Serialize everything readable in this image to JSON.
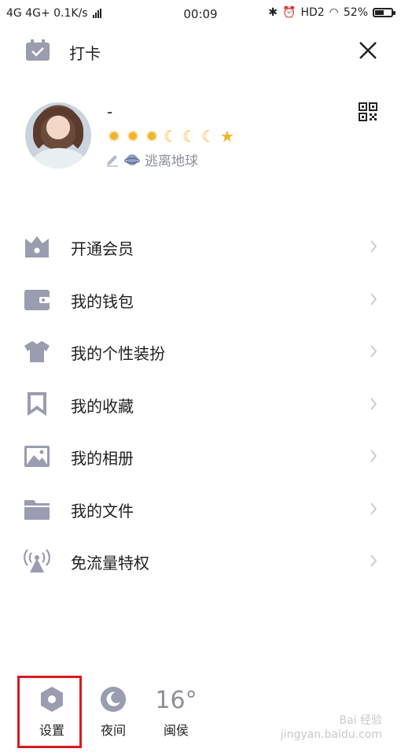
{
  "status_bar": {
    "left": "4G 4G+ 0.1K/s",
    "time": "00:09",
    "right": "HD2",
    "battery": "52%",
    "battery_level": 0.52
  },
  "header": {
    "title": "打卡",
    "close_icon": "close-icon",
    "checkin_icon": "calendar-check-icon"
  },
  "profile": {
    "nickname": "-",
    "levels": [
      "sun",
      "sun",
      "sun",
      "moon",
      "moon",
      "moon",
      "star"
    ],
    "status": "逃离地球",
    "qr_icon": "qr-code-icon"
  },
  "menu": {
    "items": [
      {
        "label": "开通会员",
        "icon": "crown-icon"
      },
      {
        "label": "我的钱包",
        "icon": "wallet-icon"
      },
      {
        "label": "我的个性装扮",
        "icon": "shirt-icon"
      },
      {
        "label": "我的收藏",
        "icon": "bookmark-icon"
      },
      {
        "label": "我的相册",
        "icon": "image-icon"
      },
      {
        "label": "我的文件",
        "icon": "folder-icon"
      },
      {
        "label": "免流量特权",
        "icon": "antenna-icon"
      }
    ]
  },
  "bottom_bar": {
    "settings_label": "设置",
    "night_label": "夜间",
    "weather_temp": "16°",
    "weather_city": "闽侯"
  },
  "watermark": {
    "line1": "Bai 经验",
    "line2": "jingyan.baidu.com"
  },
  "colors": {
    "icon": "#9a9cb0",
    "highlight": "#d9191f",
    "level": "#f3b429"
  }
}
